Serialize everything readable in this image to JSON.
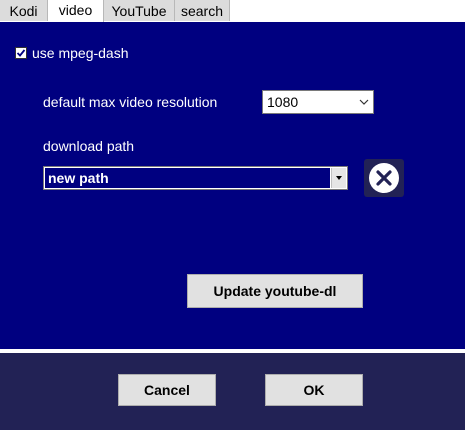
{
  "tabs": [
    {
      "label": "Kodi"
    },
    {
      "label": "video",
      "active": true
    },
    {
      "label": "YouTube"
    },
    {
      "label": "search"
    }
  ],
  "video_panel": {
    "use_mpeg_dash": {
      "label": "use mpeg-dash",
      "checked": true
    },
    "max_resolution": {
      "label": "default max video resolution",
      "value": "1080"
    },
    "download_path": {
      "label": "download path",
      "value": "new path"
    },
    "update_button": "Update youtube-dl"
  },
  "footer": {
    "cancel_label": "Cancel",
    "ok_label": "OK"
  },
  "colors": {
    "panel_bg": "#000080",
    "footer_bg": "#222255",
    "text": "#ffffff"
  }
}
